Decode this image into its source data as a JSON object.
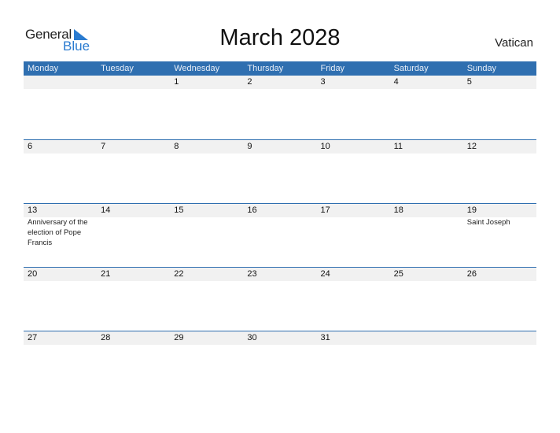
{
  "logo": {
    "word1": "General",
    "word2": "Blue"
  },
  "title": "March 2028",
  "country": "Vatican",
  "colors": {
    "header_bg": "#2f6fb0",
    "day_bar_bg": "#f1f1f1",
    "brand_blue": "#2a7bd0"
  },
  "weekdays": [
    "Monday",
    "Tuesday",
    "Wednesday",
    "Thursday",
    "Friday",
    "Saturday",
    "Sunday"
  ],
  "weeks": [
    {
      "days": [
        {
          "num": "",
          "event": ""
        },
        {
          "num": "",
          "event": ""
        },
        {
          "num": "1",
          "event": ""
        },
        {
          "num": "2",
          "event": ""
        },
        {
          "num": "3",
          "event": ""
        },
        {
          "num": "4",
          "event": ""
        },
        {
          "num": "5",
          "event": ""
        }
      ]
    },
    {
      "days": [
        {
          "num": "6",
          "event": ""
        },
        {
          "num": "7",
          "event": ""
        },
        {
          "num": "8",
          "event": ""
        },
        {
          "num": "9",
          "event": ""
        },
        {
          "num": "10",
          "event": ""
        },
        {
          "num": "11",
          "event": ""
        },
        {
          "num": "12",
          "event": ""
        }
      ]
    },
    {
      "days": [
        {
          "num": "13",
          "event": "Anniversary of the election of Pope Francis"
        },
        {
          "num": "14",
          "event": ""
        },
        {
          "num": "15",
          "event": ""
        },
        {
          "num": "16",
          "event": ""
        },
        {
          "num": "17",
          "event": ""
        },
        {
          "num": "18",
          "event": ""
        },
        {
          "num": "19",
          "event": "Saint Joseph"
        }
      ]
    },
    {
      "days": [
        {
          "num": "20",
          "event": ""
        },
        {
          "num": "21",
          "event": ""
        },
        {
          "num": "22",
          "event": ""
        },
        {
          "num": "23",
          "event": ""
        },
        {
          "num": "24",
          "event": ""
        },
        {
          "num": "25",
          "event": ""
        },
        {
          "num": "26",
          "event": ""
        }
      ]
    },
    {
      "days": [
        {
          "num": "27",
          "event": ""
        },
        {
          "num": "28",
          "event": ""
        },
        {
          "num": "29",
          "event": ""
        },
        {
          "num": "30",
          "event": ""
        },
        {
          "num": "31",
          "event": ""
        },
        {
          "num": "",
          "event": ""
        },
        {
          "num": "",
          "event": ""
        }
      ]
    }
  ]
}
